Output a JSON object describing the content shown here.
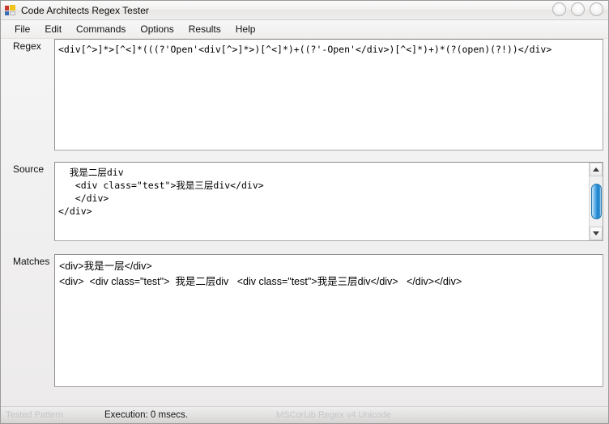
{
  "window": {
    "title": "Code Architects Regex Tester",
    "icon": "app-icon",
    "buttons": [
      {
        "name": "minimize-button",
        "glyph": ""
      },
      {
        "name": "maximize-button",
        "glyph": ""
      },
      {
        "name": "close-button",
        "glyph": ""
      }
    ]
  },
  "menubar": {
    "items": [
      {
        "label": "File"
      },
      {
        "label": "Edit"
      },
      {
        "label": "Commands"
      },
      {
        "label": "Options"
      },
      {
        "label": "Results"
      },
      {
        "label": "Help"
      }
    ]
  },
  "fields": {
    "regex": {
      "label": "Regex",
      "value": "<div[^>]*>[^<]*(((?'Open'<div[^>]*>)[^<]*)+((?'-Open'</div>)[^<]*)+)*(?(open)(?!))</div>"
    },
    "source": {
      "label": "Source",
      "value": "  我是二层div\n   <div class=\"test\">我是三层div</div>\n   </div>\n</div>"
    },
    "matches": {
      "label": "Matches",
      "value": "<div>我是一层</div>\n<div>  <div class=\"test\">  我是二层div   <div class=\"test\">我是三层div</div>   </div></div>"
    }
  },
  "scrollbar": {
    "up_arrow": "up-arrow-icon",
    "down_arrow": "down-arrow-icon",
    "thumb": "scroll-thumb"
  },
  "statusbar": {
    "left": "Tested Pattern",
    "middle": "Execution: 0 msecs.",
    "right": "MSCorLib Regex v4 Unicode"
  },
  "colors": {
    "accent": "#1b7fc6",
    "window_bg": "#f0f0f0",
    "field_bg": "#ffffff",
    "border": "#a9a9a9"
  }
}
